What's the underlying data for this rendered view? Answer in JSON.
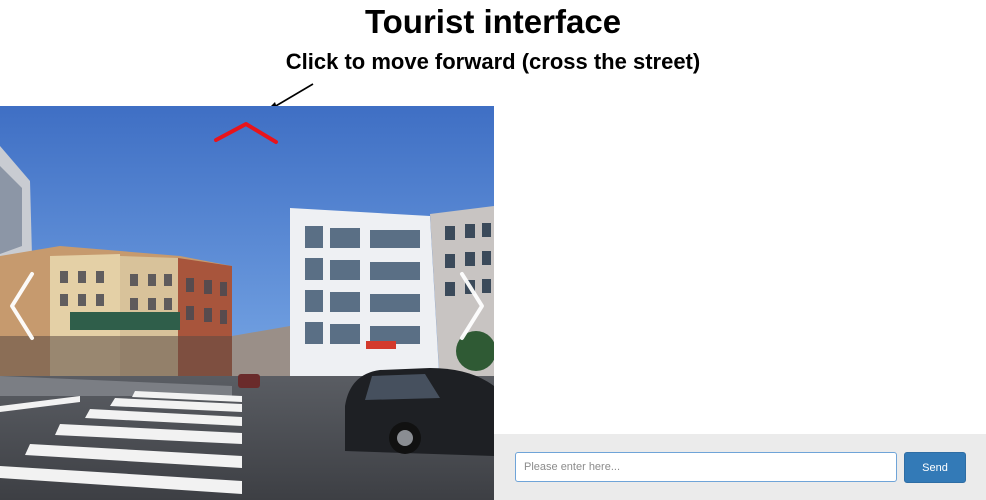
{
  "header": {
    "title": "Tourist interface",
    "subtitle": "Click to move forward (cross the street)"
  },
  "street_view": {
    "nav_forward_icon": "chevron-up-icon",
    "nav_left_icon": "chevron-left-icon",
    "nav_right_icon": "chevron-right-icon",
    "forward_color": "#e8141b"
  },
  "chat": {
    "input_placeholder": "Please enter here...",
    "input_value": "",
    "send_label": "Send"
  },
  "colors": {
    "send_button": "#337ab7",
    "input_border": "#6fa4d8",
    "footer_bg": "#ebebeb"
  }
}
